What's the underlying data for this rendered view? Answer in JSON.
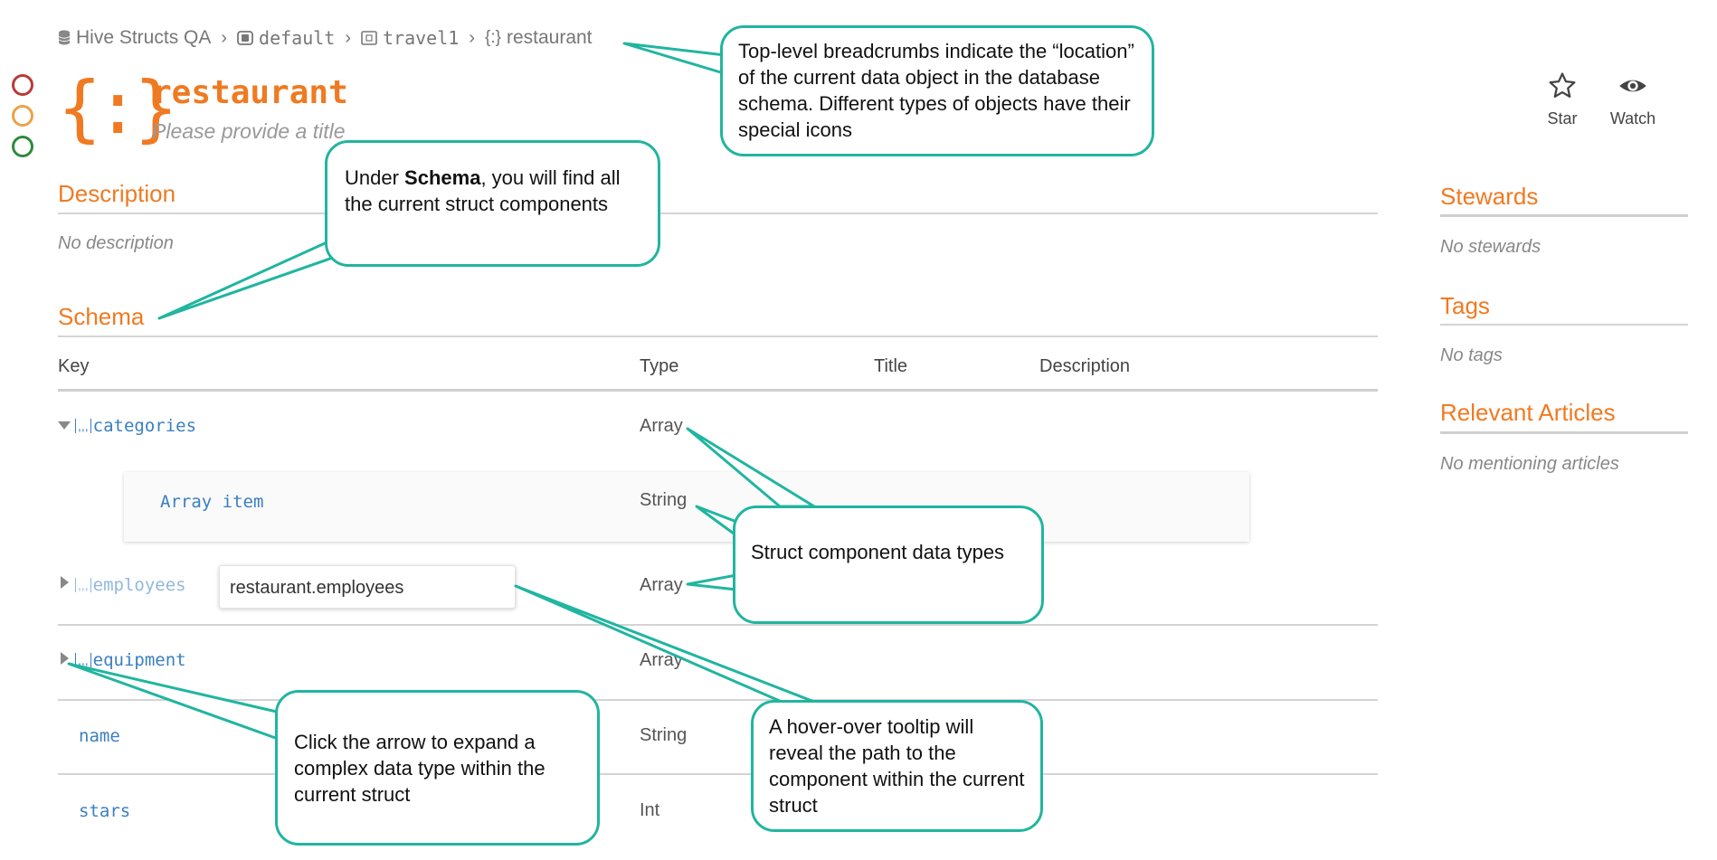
{
  "breadcrumb": {
    "database": "Hive Structs QA",
    "schema": "default",
    "table": "travel1",
    "current": "restaurant"
  },
  "header": {
    "title": "restaurant",
    "subtitle": "Please provide a title",
    "star_label": "Star",
    "watch_label": "Watch"
  },
  "description": {
    "heading": "Description",
    "empty_text": "No description"
  },
  "schema": {
    "heading": "Schema",
    "columns": {
      "key": "Key",
      "type": "Type",
      "title": "Title",
      "description": "Description"
    },
    "rows": [
      {
        "key": "categories",
        "type": "Array"
      },
      {
        "key": "Array item",
        "type": "String"
      },
      {
        "key": "employees",
        "type": "Array"
      },
      {
        "key": "equipment",
        "type": "Array"
      },
      {
        "key": "name",
        "type": "String"
      },
      {
        "key": "stars",
        "type": "Int"
      }
    ],
    "tooltip": "restaurant.employees"
  },
  "sidebar": {
    "stewards_heading": "Stewards",
    "stewards_empty": "No stewards",
    "tags_heading": "Tags",
    "tags_empty": "No tags",
    "articles_heading": "Relevant Articles",
    "articles_empty": "No mentioning articles"
  },
  "callouts": {
    "breadcrumbs": "Top-level breadcrumbs indicate the “location” of the current data object in the database schema. Different types of objects have their special icons",
    "schema_pre": "Under ",
    "schema_bold": "Schema",
    "schema_post": ", you will find all the current struct components",
    "types": "Struct component data types",
    "expand": "Click the arrow to expand a complex data type within the current struct",
    "tooltip": "A hover-over tooltip will reveal the path to the component within the current struct"
  },
  "colors": {
    "accent": "#f07a22",
    "link": "#3a7fc1",
    "callout_border": "#21b5a0",
    "ring_red": "#b83a3a",
    "ring_orange": "#e9a34a",
    "ring_green": "#2f8a3c"
  },
  "icons": [
    "database-icon",
    "schema-icon",
    "table-icon",
    "struct-icon",
    "star-icon",
    "eye-icon",
    "array-icon"
  ]
}
